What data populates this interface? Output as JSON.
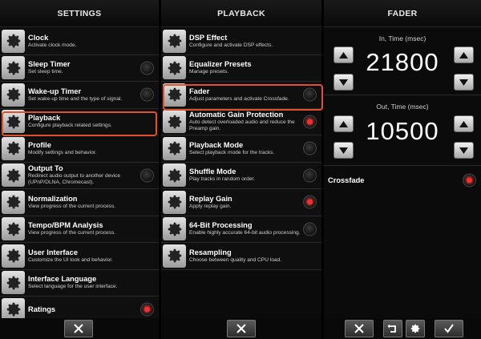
{
  "settings": {
    "header": "SETTINGS",
    "items": [
      {
        "title": "Clock",
        "desc": "Activate clock mode.",
        "radio": "none"
      },
      {
        "title": "Sleep Timer",
        "desc": "Set sleep time.",
        "radio": "off"
      },
      {
        "title": "Wake-up Timer",
        "desc": "Set wake-up time and the type of signal.",
        "radio": "off"
      },
      {
        "title": "Playback",
        "desc": "Configure playback related settings.",
        "radio": "none"
      },
      {
        "title": "Profile",
        "desc": "Modify settings and behavior.",
        "radio": "none"
      },
      {
        "title": "Output To",
        "desc": "Redirect audio output to another device (UPnP/DLNA, Chromecast).",
        "radio": "off"
      },
      {
        "title": "Normalization",
        "desc": "View progress of the current process.",
        "radio": "none"
      },
      {
        "title": "Tempo/BPM Analysis",
        "desc": "View progress of the current process.",
        "radio": "none"
      },
      {
        "title": "User Interface",
        "desc": "Customize the UI look and behavior.",
        "radio": "none"
      },
      {
        "title": "Interface Language",
        "desc": "Select language for the user interface.",
        "radio": "none"
      },
      {
        "title": "Ratings",
        "desc": "",
        "radio": "on"
      }
    ]
  },
  "playback": {
    "header": "PLAYBACK",
    "items": [
      {
        "title": "DSP Effect",
        "desc": "Configure and activate DSP effects.",
        "radio": "none"
      },
      {
        "title": "Equalizer Presets",
        "desc": "Manage presets.",
        "radio": "none"
      },
      {
        "title": "Fader",
        "desc": "Adjust parameters and activate Crossfade.",
        "radio": "off"
      },
      {
        "title": "Automatic Gain Protection",
        "desc": "Auto detect overloaded audio and reduce the Preamp gain.",
        "radio": "on"
      },
      {
        "title": "Playback Mode",
        "desc": "Select playback mode for the tracks.",
        "radio": "off"
      },
      {
        "title": "Shuffle Mode",
        "desc": "Play tracks in random order.",
        "radio": "off"
      },
      {
        "title": "Replay Gain",
        "desc": "Apply replay gain.",
        "radio": "on"
      },
      {
        "title": "64-Bit Processing",
        "desc": "Enable highly accurate 64-bit audio processing.",
        "radio": "off"
      },
      {
        "title": "Resampling",
        "desc": "Choose between quality and CPU load.",
        "radio": "none"
      }
    ]
  },
  "fader": {
    "header": "FADER",
    "in_label": "In, Time (msec)",
    "in_value": "21800",
    "out_label": "Out, Time (msec)",
    "out_value": "10500",
    "crossfade_label": "Crossfade",
    "crossfade_on": true
  },
  "colors": {
    "highlight": "#e0522a",
    "radio_on": "#ff2a2a"
  }
}
